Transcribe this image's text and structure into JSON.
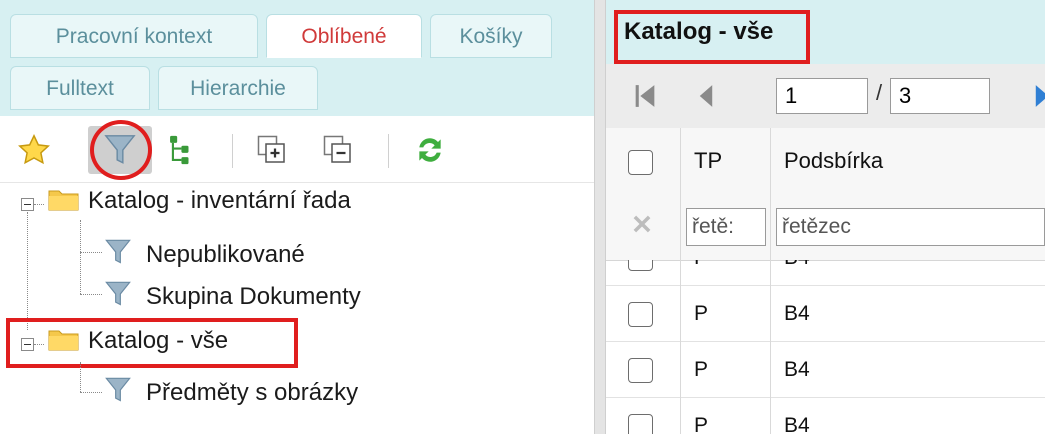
{
  "left_panel": {
    "tabs": [
      {
        "label": "Pracovní kontext",
        "active": false
      },
      {
        "label": "Oblíbené",
        "active": true
      },
      {
        "label": "Košíky",
        "active": false
      },
      {
        "label": "Fulltext",
        "active": false
      },
      {
        "label": "Hierarchie",
        "active": false
      }
    ],
    "toolbar_icons": [
      "star-icon",
      "filter-icon",
      "tree-icon",
      "add-copy-icon",
      "remove-copy-icon",
      "refresh-icon"
    ],
    "tree": [
      {
        "label": "Katalog - inventární řada",
        "children": [
          "Nepublikované",
          "Skupina Dokumenty"
        ]
      },
      {
        "label": "Katalog - vše",
        "children": [
          "Předměty s obrázky"
        ]
      }
    ]
  },
  "right_panel": {
    "title": "Katalog - vše",
    "pager": {
      "page": "1",
      "total": "3",
      "separator": "/"
    },
    "columns": [
      "TP",
      "Podsbírka"
    ],
    "filters": {
      "tp_placeholder": "řetě:",
      "podsbirka_placeholder": "řetězec"
    },
    "rows": [
      {
        "tp": "P",
        "podsbirka": "B4"
      },
      {
        "tp": "P",
        "podsbirka": "B4"
      },
      {
        "tp": "P",
        "podsbirka": "B4"
      },
      {
        "tp": "P",
        "podsbirka": "B4"
      }
    ]
  },
  "colors": {
    "highlight": "#e01e1e",
    "panel_bg": "#d7f0f2",
    "active_tab_text": "#d03a3a"
  }
}
